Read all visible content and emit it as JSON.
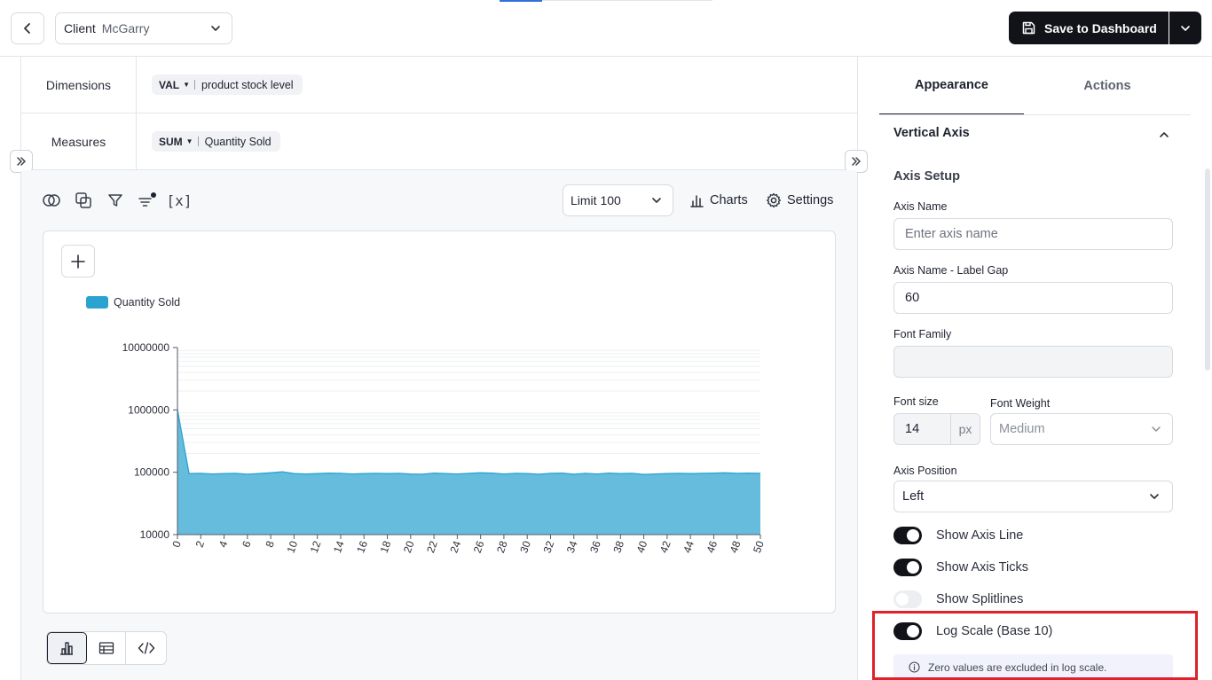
{
  "header": {
    "client_label": "Client",
    "client_value": "McGarry",
    "save_label": "Save to Dashboard"
  },
  "query": {
    "dimensions_label": "Dimensions",
    "dimension_agg": "VAL",
    "dimension_field": "product stock level",
    "measures_label": "Measures",
    "measure_agg": "SUM",
    "measure_field": "Quantity Sold"
  },
  "toolbar": {
    "variables_label": "[x]",
    "limit_value": "Limit 100",
    "charts_label": "Charts",
    "settings_label": "Settings"
  },
  "chart_data": {
    "type": "area",
    "legend_position": "top-left",
    "y_scale": "log",
    "ylim": [
      10000,
      10000000
    ],
    "y_ticks": [
      "10000000",
      "1000000",
      "100000",
      "10000"
    ],
    "x_ticks": [
      "0",
      "2",
      "4",
      "6",
      "8",
      "10",
      "12",
      "14",
      "16",
      "18",
      "20",
      "22",
      "24",
      "26",
      "28",
      "30",
      "32",
      "34",
      "36",
      "38",
      "40",
      "42",
      "44",
      "46",
      "48",
      "50"
    ],
    "series": [
      {
        "name": "Quantity Sold",
        "color": "#65bcdd",
        "x": [
          0,
          1,
          2,
          3,
          4,
          5,
          6,
          7,
          8,
          9,
          10,
          11,
          12,
          13,
          14,
          15,
          16,
          17,
          18,
          19,
          20,
          21,
          22,
          23,
          24,
          25,
          26,
          27,
          28,
          29,
          30,
          31,
          32,
          33,
          34,
          35,
          36,
          37,
          38,
          39,
          40,
          41,
          42,
          43,
          44,
          45,
          46,
          47,
          48,
          49,
          50
        ],
        "values": [
          1000000,
          95000,
          96000,
          94000,
          95000,
          96000,
          93000,
          95000,
          98000,
          102000,
          95000,
          94000,
          95000,
          97000,
          96000,
          94000,
          95000,
          96000,
          95000,
          96000,
          94000,
          93000,
          97000,
          95000,
          94000,
          96000,
          98000,
          97000,
          94000,
          96000,
          95000,
          93000,
          96000,
          97000,
          93000,
          96000,
          94000,
          97000,
          95000,
          96000,
          92000,
          94000,
          95000,
          96000,
          95000,
          96000,
          97000,
          98000,
          96000,
          97000,
          96000
        ]
      }
    ]
  },
  "panel": {
    "tab_appearance": "Appearance",
    "tab_actions": "Actions",
    "section_title": "Vertical Axis",
    "subsection_title": "Axis Setup",
    "axis_name_label": "Axis Name",
    "axis_name_placeholder": "Enter axis name",
    "label_gap_label": "Axis Name - Label Gap",
    "label_gap_value": "60",
    "font_family_label": "Font Family",
    "font_family_value": "",
    "font_size_label": "Font size",
    "font_size_value": "14",
    "font_size_unit": "px",
    "font_weight_label": "Font Weight",
    "font_weight_value": "Medium",
    "axis_position_label": "Axis Position",
    "axis_position_value": "Left",
    "toggles": [
      {
        "label": "Show Axis Line",
        "on": true
      },
      {
        "label": "Show Axis Ticks",
        "on": true
      },
      {
        "label": "Show Splitlines",
        "on": false
      },
      {
        "label": "Log Scale (Base 10)",
        "on": true
      }
    ],
    "info_text": "Zero values are excluded in log scale."
  }
}
